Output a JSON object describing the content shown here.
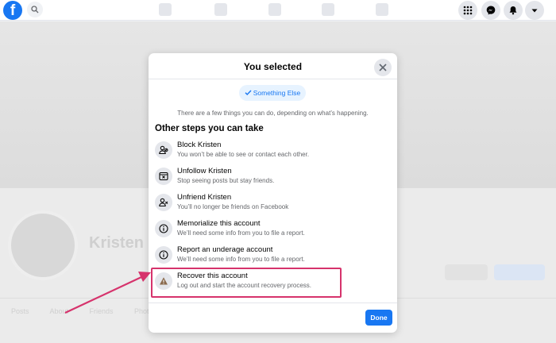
{
  "topbar": {
    "logo_letter": "f"
  },
  "background": {
    "profile_name": "Kristen P",
    "tabs": "Posts About Friends Photos More"
  },
  "modal": {
    "title": "You selected",
    "selected_option": "Something Else",
    "intro": "There are a few things you can do, depending on what’s happening.",
    "section_heading": "Other steps you can take",
    "options": [
      {
        "title": "Block Kristen",
        "subtitle": "You won’t be able to see or contact each other.",
        "icon": "block-user-icon"
      },
      {
        "title": "Unfollow Kristen",
        "subtitle": "Stop seeing posts but stay friends.",
        "icon": "unfollow-icon"
      },
      {
        "title": "Unfriend Kristen",
        "subtitle": "You’ll no longer be friends on Facebook",
        "icon": "unfriend-icon"
      },
      {
        "title": "Memorialize this account",
        "subtitle": "We’ll need some info from you to file a report.",
        "icon": "info-icon"
      },
      {
        "title": "Report an underage account",
        "subtitle": "We’ll need some info from you to file a report.",
        "icon": "info-icon"
      },
      {
        "title": "Recover this account",
        "subtitle": "Log out and start the account recovery process.",
        "icon": "warning-icon"
      }
    ],
    "done_label": "Done"
  },
  "colors": {
    "brand": "#1877f2",
    "highlight": "#d6336c",
    "chip_bg": "#e7f3ff"
  }
}
